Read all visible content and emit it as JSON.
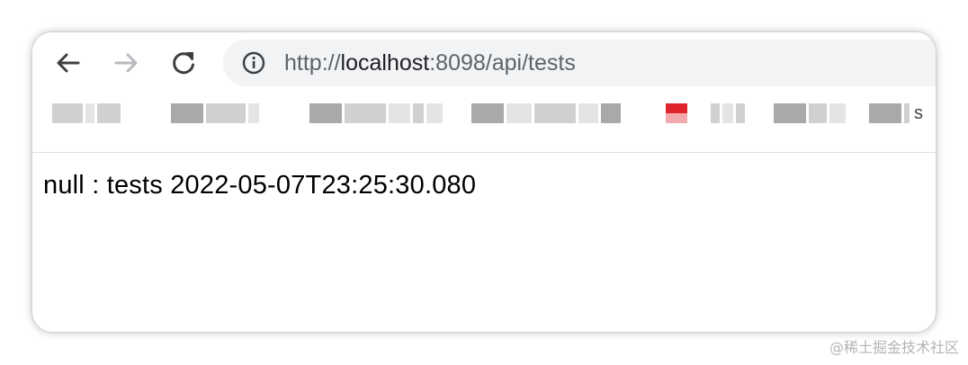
{
  "toolbar": {
    "back_icon": "arrow-left-icon",
    "forward_icon": "arrow-right-icon",
    "reload_icon": "reload-icon",
    "info_icon": "info-icon",
    "url_scheme": "http://",
    "url_host": "localhost",
    "url_rest": ":8098/api/tests"
  },
  "bookmarks": {
    "note": "blurred bookmark items",
    "last_item_tail": "s"
  },
  "page": {
    "body_text": "null : tests 2022-05-07T23:25:30.080"
  },
  "watermark": "@稀土掘金技术社区",
  "colors": {
    "omnibox_bg": "#f1f3f4",
    "icon_active": "#5f6368",
    "icon_disabled": "#b8babd",
    "bookmark_red": "#e0242e"
  }
}
